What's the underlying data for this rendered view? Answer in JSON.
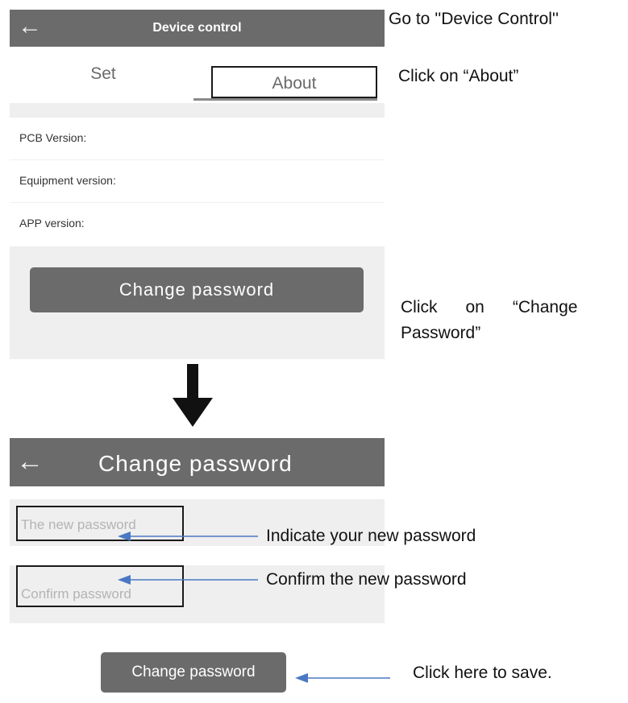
{
  "screen1": {
    "header": {
      "back_icon": "arrow-left-icon",
      "title": "Device control"
    },
    "tabs": [
      {
        "label": "Set"
      },
      {
        "label": "About"
      }
    ],
    "info_rows": [
      {
        "label": "PCB Version:"
      },
      {
        "label": "Equipment version:"
      },
      {
        "label": "APP version:"
      }
    ],
    "change_password_button": "Change password"
  },
  "screen2": {
    "header": {
      "back_icon": "arrow-left-icon",
      "title": "Change password"
    },
    "fields": {
      "new_password_placeholder": "The new password",
      "confirm_password_placeholder": "Confirm password"
    },
    "save_button": "Change password"
  },
  "annotations": {
    "step1": "Go to ''Device Control''",
    "step2": "Click on “About”",
    "step3_line1": "Click      on      “Change",
    "step3_line2": "Password”",
    "new_password": "Indicate your new password",
    "confirm_password": "Confirm the new password",
    "save": "Click here to save."
  },
  "colors": {
    "header_gray": "#6b6b6b",
    "panel_gray": "#efefef",
    "annotation_arrow": "#4a78c4",
    "flow_arrow": "#111111"
  }
}
